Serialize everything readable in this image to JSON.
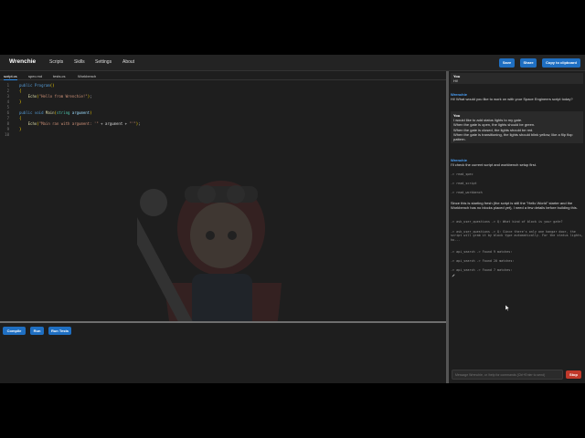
{
  "navbar": {
    "brand": "Wrenchie",
    "links": [
      "Scripts",
      "Skills",
      "Settings",
      "About"
    ],
    "buttons": {
      "save": "Save",
      "share": "Share",
      "copy": "Copy to clipboard"
    }
  },
  "tabs": [
    "script.cs",
    "spec.md",
    "tests.cs",
    "Workbench"
  ],
  "code": [
    {
      "n": "1",
      "parts": [
        [
          "kw",
          "public "
        ],
        [
          "kw",
          "Program"
        ],
        [
          "br",
          "()"
        ]
      ]
    },
    {
      "n": "2",
      "parts": [
        [
          "br",
          "{"
        ]
      ]
    },
    {
      "n": "3",
      "parts": [
        [
          "",
          "    "
        ],
        [
          "fn",
          "Echo"
        ],
        [
          "br",
          "("
        ],
        [
          "str",
          "\"Hello from Wrenchie!\""
        ],
        [
          "br",
          ")"
        ],
        [
          "",
          ";"
        ]
      ]
    },
    {
      "n": "4",
      "parts": [
        [
          "br",
          "}"
        ]
      ]
    },
    {
      "n": "5",
      "parts": []
    },
    {
      "n": "6",
      "parts": [
        [
          "kw",
          "public "
        ],
        [
          "kw",
          "void "
        ],
        [
          "fn",
          "Main"
        ],
        [
          "br",
          "("
        ],
        [
          "ty",
          "string "
        ],
        [
          "par",
          "argument"
        ],
        [
          "br",
          ")"
        ]
      ]
    },
    {
      "n": "7",
      "parts": [
        [
          "br",
          "{"
        ]
      ]
    },
    {
      "n": "8",
      "parts": [
        [
          "",
          "    "
        ],
        [
          "fn",
          "Echo"
        ],
        [
          "br",
          "("
        ],
        [
          "str",
          "\"Main ran with argument: '\""
        ],
        [
          "",
          " + argument + "
        ],
        [
          "str",
          "\"'\""
        ],
        [
          "br",
          ")"
        ],
        [
          "",
          ";"
        ]
      ]
    },
    {
      "n": "9",
      "parts": [
        [
          "br",
          "}"
        ]
      ]
    },
    {
      "n": "10",
      "parts": []
    }
  ],
  "actions": {
    "compile": "Compile",
    "run": "Run",
    "run_tests": "Run Tests"
  },
  "chat": {
    "user1": {
      "sender": "You",
      "text": "Hi!"
    },
    "bot1": {
      "sender": "Wrenchie",
      "text": "Hi! What would you like to work on with your Space Engineers script today?"
    },
    "user2": {
      "sender": "You",
      "lines": [
        "I would like to add status lights to my gate.",
        "When the gate is open, the lights should be green.",
        "When the gate is closed, the lights should be red.",
        "When the gate is transitioning, the lights should blink yellow, like a flip flop pattern."
      ]
    },
    "bot2": {
      "sender": "Wrenchie",
      "text": "I'll check the current script and workbench setup first."
    },
    "tools": [
      "-> read_spec",
      "-> read_script",
      "-> read_workbench"
    ],
    "bot3_text": "Since this is starting fresh (the script is still the \"Hello World\" starter and the Workbench has no blocks placed yet), I need a few details before building this.",
    "tools2": [
      "-> ask_user_questions -> Q: What kind of block is your gate?",
      "-> ask_user_questions -> Q: Since there's only one hangar door, the script will grab it by block type automatically. For the status lights, ho...",
      "-> api_search -> Found 9 matches:",
      "-> api_search -> Found 20 matches:",
      "-> api_search -> Found 7 matches:"
    ],
    "input_placeholder": "Message Wrenchie, or /help for commands (Ctrl+Enter to send)",
    "stop": "Stop"
  },
  "colors": {
    "accent": "#1f6fc2",
    "stop": "#c0392b",
    "link": "#4aa3ff"
  }
}
